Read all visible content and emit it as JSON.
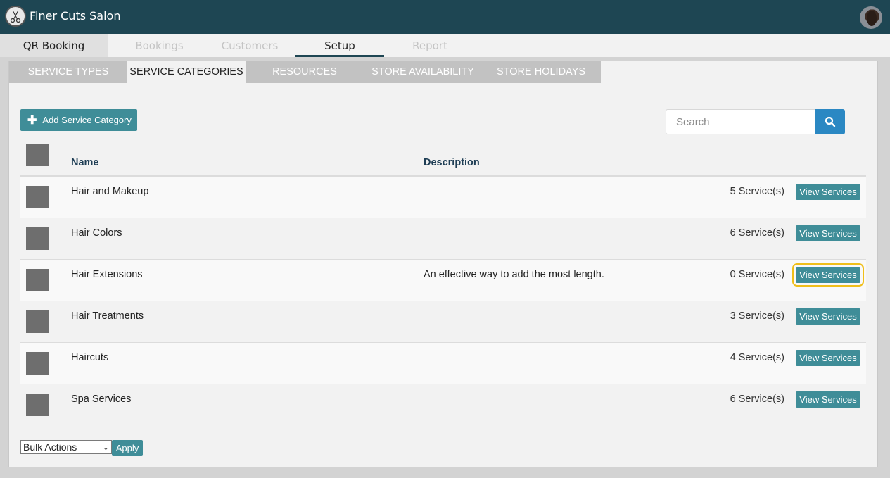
{
  "app": {
    "title": "Finer Cuts Salon"
  },
  "nav": {
    "tabs": [
      {
        "label": "QR Booking"
      },
      {
        "label": "Bookings"
      },
      {
        "label": "Customers"
      },
      {
        "label": "Setup"
      },
      {
        "label": "Report"
      }
    ],
    "active": "Setup"
  },
  "subtabs": [
    {
      "label": "SERVICE TYPES"
    },
    {
      "label": "SERVICE CATEGORIES"
    },
    {
      "label": "RESOURCES"
    },
    {
      "label": "STORE AVAILABILITY"
    },
    {
      "label": "STORE HOLIDAYS"
    }
  ],
  "toolbar": {
    "add_label": "Add Service Category",
    "search_placeholder": "Search"
  },
  "table": {
    "columns": {
      "name": "Name",
      "description": "Description"
    },
    "view_label": "View Services",
    "rows": [
      {
        "name": "Hair and Makeup",
        "description": "",
        "count": "5 Service(s)"
      },
      {
        "name": "Hair Colors",
        "description": "",
        "count": "6 Service(s)"
      },
      {
        "name": "Hair Extensions",
        "description": "An effective way to add the most length.",
        "count": "0 Service(s)"
      },
      {
        "name": "Hair Treatments",
        "description": "",
        "count": "3 Service(s)"
      },
      {
        "name": "Haircuts",
        "description": "",
        "count": "4 Service(s)"
      },
      {
        "name": "Spa Services",
        "description": "",
        "count": "6 Service(s)"
      }
    ]
  },
  "footer": {
    "bulk_label": "Bulk Actions",
    "apply_label": "Apply"
  },
  "colors": {
    "header": "#1e4653",
    "accent": "#3f8d98",
    "search": "#2b88c3",
    "highlight": "#f0bf1a"
  }
}
